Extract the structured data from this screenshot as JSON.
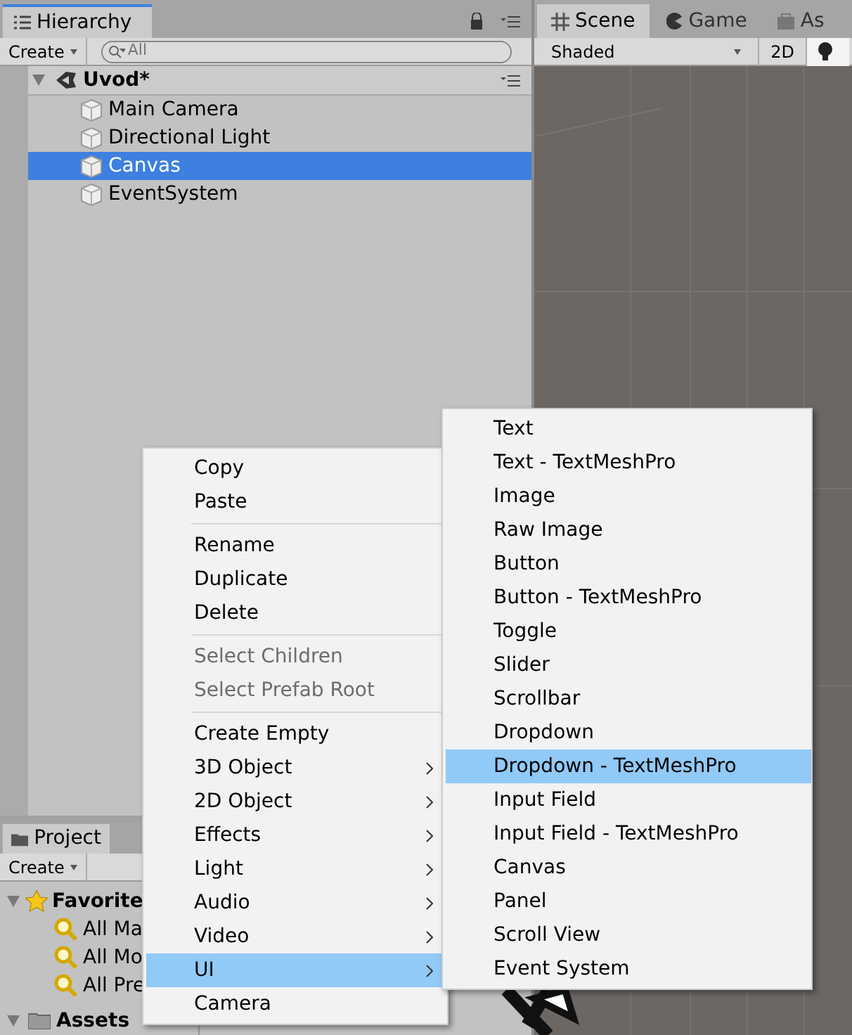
{
  "hierarchy": {
    "tab": "Hierarchy",
    "create": "Create",
    "search_placeholder": "All",
    "scene": "Uvod*",
    "items": [
      {
        "label": "Main Camera",
        "selected": false
      },
      {
        "label": "Directional Light",
        "selected": false
      },
      {
        "label": "Canvas",
        "selected": true
      },
      {
        "label": "EventSystem",
        "selected": false
      }
    ]
  },
  "scene_view": {
    "tabs": [
      {
        "label": "Scene",
        "selected": true
      },
      {
        "label": "Game",
        "selected": false
      },
      {
        "label": "As",
        "selected": false
      }
    ],
    "shading": "Shaded",
    "mode_2d": "2D",
    "lighting_on": true
  },
  "project": {
    "tab": "Project",
    "create": "Create",
    "favorites": "Favorite",
    "items": [
      "All Ma",
      "All Mo",
      "All Pre"
    ],
    "assets": "Assets"
  },
  "context_menu": {
    "groups": [
      [
        {
          "label": "Copy",
          "disabled": false,
          "submenu": false,
          "selected": false
        },
        {
          "label": "Paste",
          "disabled": false,
          "submenu": false,
          "selected": false
        }
      ],
      [
        {
          "label": "Rename",
          "disabled": false,
          "submenu": false,
          "selected": false
        },
        {
          "label": "Duplicate",
          "disabled": false,
          "submenu": false,
          "selected": false
        },
        {
          "label": "Delete",
          "disabled": false,
          "submenu": false,
          "selected": false
        }
      ],
      [
        {
          "label": "Select Children",
          "disabled": true,
          "submenu": false,
          "selected": false
        },
        {
          "label": "Select Prefab Root",
          "disabled": true,
          "submenu": false,
          "selected": false
        }
      ],
      [
        {
          "label": "Create Empty",
          "disabled": false,
          "submenu": false,
          "selected": false
        },
        {
          "label": "3D Object",
          "disabled": false,
          "submenu": true,
          "selected": false
        },
        {
          "label": "2D Object",
          "disabled": false,
          "submenu": true,
          "selected": false
        },
        {
          "label": "Effects",
          "disabled": false,
          "submenu": true,
          "selected": false
        },
        {
          "label": "Light",
          "disabled": false,
          "submenu": true,
          "selected": false
        },
        {
          "label": "Audio",
          "disabled": false,
          "submenu": true,
          "selected": false
        },
        {
          "label": "Video",
          "disabled": false,
          "submenu": true,
          "selected": false
        },
        {
          "label": "UI",
          "disabled": false,
          "submenu": true,
          "selected": true
        },
        {
          "label": "Camera",
          "disabled": false,
          "submenu": false,
          "selected": false
        }
      ]
    ]
  },
  "submenu": {
    "items": [
      {
        "label": "Text",
        "selected": false
      },
      {
        "label": "Text - TextMeshPro",
        "selected": false
      },
      {
        "label": "Image",
        "selected": false
      },
      {
        "label": "Raw Image",
        "selected": false
      },
      {
        "label": "Button",
        "selected": false
      },
      {
        "label": "Button - TextMeshPro",
        "selected": false
      },
      {
        "label": "Toggle",
        "selected": false
      },
      {
        "label": "Slider",
        "selected": false
      },
      {
        "label": "Scrollbar",
        "selected": false
      },
      {
        "label": "Dropdown",
        "selected": false
      },
      {
        "label": "Dropdown - TextMeshPro",
        "selected": true
      },
      {
        "label": "Input Field",
        "selected": false
      },
      {
        "label": "Input Field - TextMeshPro",
        "selected": false
      },
      {
        "label": "Canvas",
        "selected": false
      },
      {
        "label": "Panel",
        "selected": false
      },
      {
        "label": "Scroll View",
        "selected": false
      },
      {
        "label": "Event System",
        "selected": false
      }
    ]
  }
}
